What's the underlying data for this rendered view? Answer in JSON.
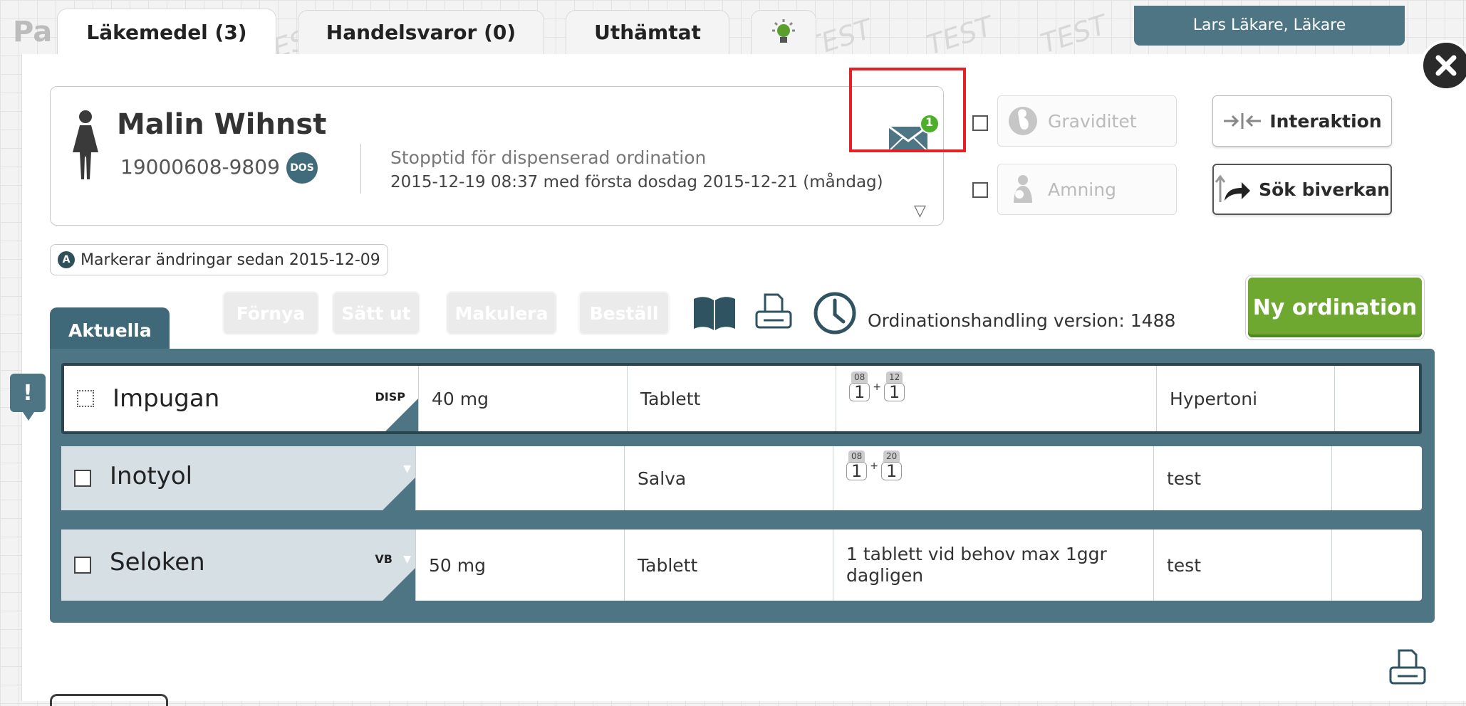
{
  "tabs": [
    {
      "label": "Läkemedel (3)"
    },
    {
      "label": "Handelsvaror (0)"
    },
    {
      "label": "Uthämtat"
    }
  ],
  "user": "Lars Läkare, Läkare",
  "patient": {
    "name": "Malin Wihnst",
    "id": "19000608-9809",
    "badge": "DOS",
    "stop_title": "Stopptid för dispenserad ordination",
    "stop_detail": "2015-12-19 08:37 med första dosdag 2015-12-21 (måndag)",
    "message_count": "1"
  },
  "flags": {
    "graviditet": "Graviditet",
    "amning": "Amning"
  },
  "actions": {
    "interaktion": "Interaktion",
    "sok_biverkan": "Sök biverkan"
  },
  "marker_text": "Markerar ändringar sedan 2015-12-09",
  "marker_badge": "A",
  "toolbar": {
    "fornya": "Förnya",
    "satt_ut": "Sätt ut",
    "makulera": "Makulera",
    "bestall": "Beställ",
    "version": "Ordinationshandling version: 1488",
    "ny_ordination": "Ny ordination"
  },
  "list": {
    "tab": "Aktuella",
    "alert": "!",
    "rows": [
      {
        "name": "Impugan",
        "type": "DISP",
        "strength": "40 mg",
        "form": "Tablett",
        "dose": [
          {
            "time": "08",
            "val": "1"
          },
          {
            "time": "12",
            "val": "1"
          }
        ],
        "dose_sep": "+",
        "dose_text": "",
        "indication": "Hypertoni"
      },
      {
        "name": "Inotyol",
        "type": "",
        "strength": "",
        "form": "Salva",
        "dose": [
          {
            "time": "08",
            "val": "1"
          },
          {
            "time": "20",
            "val": "1"
          }
        ],
        "dose_sep": "+",
        "dose_text": "",
        "indication": "test"
      },
      {
        "name": "Seloken",
        "type": "VB",
        "strength": "50 mg",
        "form": "Tablett",
        "dose": [],
        "dose_sep": "",
        "dose_text": "1 tablett vid behov max 1ggr dagligen",
        "indication": "test"
      }
    ]
  },
  "colors": {
    "header_teal": "#4e7584",
    "accent_green": "#6fa831",
    "highlight_red": "#e32228",
    "badge_green": "#4caf28"
  },
  "icons": [
    "female-icon",
    "mail-icon",
    "pregnancy-icon",
    "breastfeeding-icon",
    "interaction-arrows-icon",
    "share-arrow-icon",
    "book-icon",
    "print-icon",
    "clock-icon",
    "close-icon",
    "lightbulb-icon"
  ]
}
